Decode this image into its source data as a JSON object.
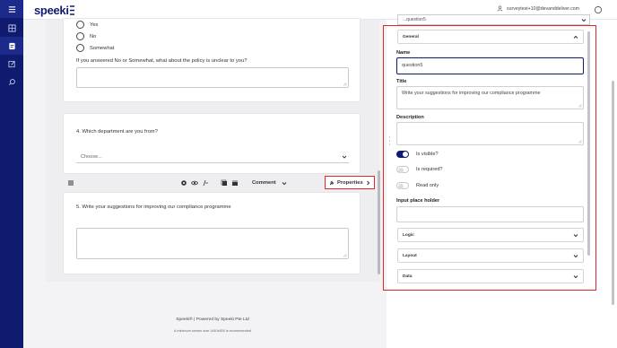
{
  "app": {
    "logo_text": "speeki"
  },
  "sidebar": {
    "items": [
      {
        "icon": "menu-icon",
        "active": true
      },
      {
        "icon": "dashboard-icon",
        "active": false
      },
      {
        "icon": "survey-icon",
        "active": true
      },
      {
        "icon": "edit-icon",
        "active": false
      },
      {
        "icon": "search-icon",
        "active": false
      }
    ]
  },
  "header": {
    "user_email": "surveytest+10@devanddeliver.com"
  },
  "survey": {
    "q3": {
      "options": [
        "Yes",
        "No",
        "Somewhat"
      ],
      "followup": "If you answered No or Somewhat, what about the policy is unclear to you?"
    },
    "q4": {
      "text": "4.   Which department are you from?",
      "select_placeholder": "Choose..."
    },
    "toolbar": {
      "type_label": "Comment",
      "properties_label": "Properties"
    },
    "q5": {
      "text": "5.   Write your suggestions for improving our compliance programme"
    }
  },
  "footer": {
    "line1": "Speeki®  |  Powered by Speeki Pte Ltd",
    "line2": "A minimum screen size 1440x900 is recommended"
  },
  "properties": {
    "top_select": "...question5",
    "general_label": "General",
    "name_label": "Name",
    "name_value": "question5",
    "title_label": "Title",
    "title_value": "Write your suggestions for improving our compliance programme",
    "description_label": "Description",
    "visible_label": "Is visible?",
    "required_label": "Is required?",
    "readonly_label": "Read only",
    "placeholder_label": "Input place holder",
    "logic_label": "Logic",
    "layout_label": "Layout",
    "data_label": "Data",
    "visible": true,
    "required": false,
    "readonly": false
  },
  "colors": {
    "brand": "#0f1b6e",
    "highlight": "#e5252a"
  }
}
